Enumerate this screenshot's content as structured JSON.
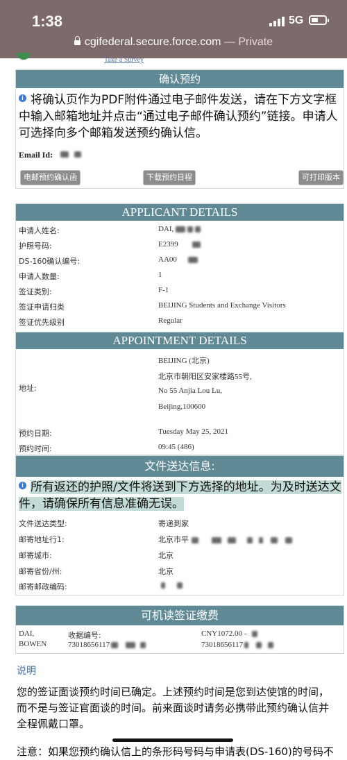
{
  "status": {
    "time": "1:38",
    "network": "5G"
  },
  "browser": {
    "url": "cgifederal.secure.force.com",
    "separator": " — ",
    "mode": "Private"
  },
  "survey_link": "Take a Survey",
  "confirm": {
    "title": "确认预约",
    "notice": "将确认页作为PDF附件通过电子邮件发送，请在下方文字框中输入邮箱地址并点击“通过电子邮件确认预约”链接。申请人可选择向多个邮箱发送预约确认信。",
    "email_label": "Email Id:",
    "buttons": {
      "email": "电邮预约确认函",
      "download": "下载预约日程",
      "print": "可打印版本"
    }
  },
  "applicant": {
    "title": "APPLICANT DETAILS",
    "rows": [
      {
        "label": "申请人姓名:",
        "value": "DAI, "
      },
      {
        "label": "护照号码:",
        "value": "E2399"
      },
      {
        "label": "DS-160确认编号:",
        "value": "AA00"
      },
      {
        "label": "申请人数量:",
        "value": "1"
      },
      {
        "label": "签证类别:",
        "value": "F-1"
      },
      {
        "label": "签证申请归类",
        "value": "BEIJING Students and Exchange Visitors"
      },
      {
        "label": "签证优先级别",
        "value": "Regular"
      }
    ]
  },
  "appointment": {
    "title": "APPOINTMENT DETAILS",
    "address_label": "地址:",
    "address_lines": [
      "BEIJING (北京)",
      "北京市朝阳区安家楼路55号,",
      "No 55 Anjia Lou Lu,",
      "Beijing,100600"
    ],
    "date_label": "预约日期:",
    "date_value": "Tuesday May 25, 2021",
    "time_label": "预约时间:",
    "time_value": "09:45 (486)"
  },
  "delivery": {
    "title": "文件送达信息:",
    "notice": "所有返还的护照/文件将送到下方选择的地址。为及时送达文件，请确保所有信息准确无误。",
    "rows": [
      {
        "label": "文件送达类型:",
        "value": "寄递到家"
      },
      {
        "label": "邮寄地址行1:",
        "value": "北京市平"
      },
      {
        "label": "邮寄城市:",
        "value": "北京"
      },
      {
        "label": "邮寄省份/州:",
        "value": "北京"
      },
      {
        "label": "邮寄邮政编码:",
        "value": ""
      }
    ]
  },
  "fee": {
    "title": "可机读签证缴费",
    "name_line1": "DAI,",
    "name_line2": "BOWEN",
    "receipt_label": "收据编号:",
    "receipt_value": "73018656117",
    "amount_line1": "CNY1072.00 -",
    "amount_line2": "73018656117"
  },
  "footer": {
    "heading": "说明",
    "paragraph": "您的签证面谈预约时间已确定。上述预约时间是您到达使馆的时间，而不是与签证官面谈的时间。前来面谈时请务必携带此预约确认信并全程佩戴口罩。",
    "note_partial": "注意：如果您预约确认信上的条形码号码与申请表(DS-160)的号码不"
  },
  "colors": {
    "header": "#5f8a95",
    "topbar": "#7d6b6b",
    "highlight": "#c3dbd6"
  }
}
